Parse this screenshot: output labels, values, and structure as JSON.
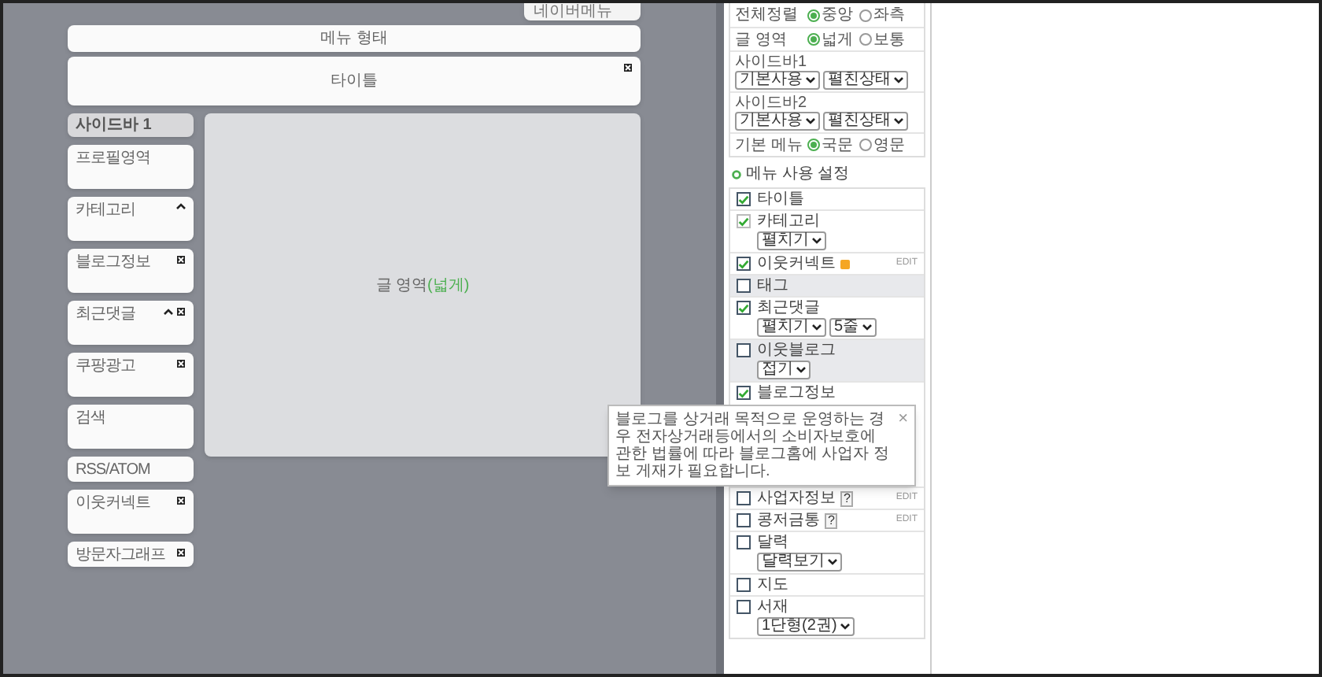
{
  "layout_preview": {
    "top_tab": "네이버메뉴",
    "menu_bar": "메뉴 형태",
    "title_block": {
      "label": "타이틀",
      "closable": true
    },
    "sidebar": {
      "header": "사이드바 1",
      "widgets": [
        {
          "label": "프로필영역",
          "kind": "tall",
          "collapsible": false,
          "closable": false
        },
        {
          "label": "카테고리",
          "kind": "tall",
          "collapsible": true,
          "closable": false
        },
        {
          "label": "블로그정보",
          "kind": "tall",
          "collapsible": false,
          "closable": true
        },
        {
          "label": "최근댓글",
          "kind": "tall",
          "collapsible": true,
          "closable": true
        },
        {
          "label": "쿠팡광고",
          "kind": "tall",
          "collapsible": false,
          "closable": true
        },
        {
          "label": "검색",
          "kind": "tall",
          "collapsible": false,
          "closable": false
        },
        {
          "label": "RSS/ATOM",
          "kind": "short",
          "collapsible": false,
          "closable": false
        },
        {
          "label": "이웃커넥트",
          "kind": "tall",
          "collapsible": false,
          "closable": true
        },
        {
          "label": "방문자그래프",
          "kind": "short",
          "collapsible": false,
          "closable": true
        }
      ]
    },
    "content": {
      "label": "글 영역",
      "mode": "(넓게)"
    }
  },
  "settings": {
    "rows": [
      {
        "kind": "radio",
        "label": "전체정렬",
        "options": [
          {
            "label": "중앙",
            "selected": true
          },
          {
            "label": "좌측",
            "selected": false
          }
        ]
      },
      {
        "kind": "radio",
        "label": "글 영역",
        "options": [
          {
            "label": "넓게",
            "selected": true
          },
          {
            "label": "보통",
            "selected": false
          }
        ]
      },
      {
        "kind": "selects",
        "label": "사이드바1",
        "selects": [
          "기본사용",
          "펼친상태"
        ]
      },
      {
        "kind": "selects",
        "label": "사이드바2",
        "selects": [
          "기본사용",
          "펼친상태"
        ]
      },
      {
        "kind": "radio",
        "label": "기본 메뉴",
        "options": [
          {
            "label": "국문",
            "selected": true
          },
          {
            "label": "영문",
            "selected": false
          }
        ]
      }
    ]
  },
  "menu_settings": {
    "title": "메뉴 사용 설정",
    "items": [
      {
        "label": "타이틀",
        "checked": true,
        "disabled": false,
        "shaded": false
      },
      {
        "label": "카테고리",
        "checked": true,
        "disabled": true,
        "shaded": false,
        "selects": [
          "펼치기"
        ]
      },
      {
        "label": "이웃커넥트",
        "checked": true,
        "disabled": false,
        "shaded": false,
        "badge_icon": true,
        "edit": "EDIT"
      },
      {
        "label": "태그",
        "checked": false,
        "disabled": false,
        "shaded": true
      },
      {
        "label": "최근댓글",
        "checked": true,
        "disabled": false,
        "shaded": false,
        "selects": [
          "펼치기",
          "5줄"
        ]
      },
      {
        "label": "이웃블로그",
        "checked": false,
        "disabled": false,
        "shaded": true,
        "selects": [
          "접기"
        ]
      },
      {
        "label": "블로그정보",
        "checked": true,
        "disabled": false,
        "shaded": false,
        "tooltip": "블로그를 상거래 목적으로 운영하는 경우 전자상거래등에서의 소비자보호에 관한 법률에 따라 블로그홈에 사업자 정보 게재가 필요합니다.",
        "tooltip_close": "×"
      },
      {
        "label": "사업자정보",
        "checked": false,
        "disabled": false,
        "shaded": false,
        "help": "?",
        "edit": "EDIT"
      },
      {
        "label": "콩저금통",
        "checked": false,
        "disabled": false,
        "shaded": false,
        "help": "?",
        "edit": "EDIT"
      },
      {
        "label": "달력",
        "checked": false,
        "disabled": false,
        "shaded": false,
        "selects": [
          "달력보기"
        ]
      },
      {
        "label": "지도",
        "checked": false,
        "disabled": false,
        "shaded": false
      },
      {
        "label": "서재",
        "checked": false,
        "disabled": false,
        "shaded": false,
        "selects": [
          "1단형(2권)"
        ]
      }
    ]
  }
}
